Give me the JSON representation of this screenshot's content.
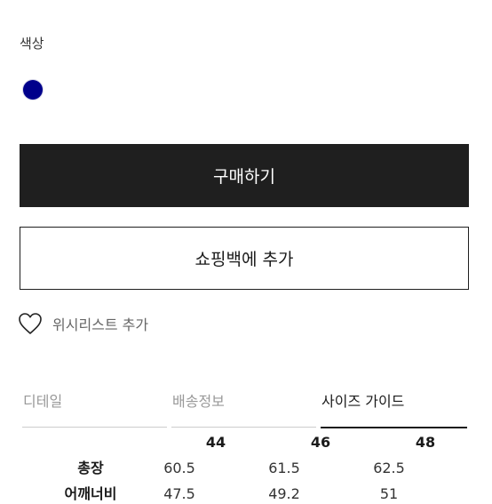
{
  "color_section": {
    "label": "색상",
    "swatch_color": "#00008b"
  },
  "buttons": {
    "buy_label": "구매하기",
    "add_to_bag_label": "쇼핑백에 추가"
  },
  "wishlist": {
    "label": "위시리스트 추가",
    "icon": "heart-outline-icon"
  },
  "tabs": [
    {
      "label": "디테일",
      "active": false
    },
    {
      "label": "배송정보",
      "active": false
    },
    {
      "label": "사이즈 가이드",
      "active": true
    }
  ],
  "size_table": {
    "sizes": [
      "44",
      "46",
      "48"
    ],
    "rows": [
      {
        "label": "총장",
        "values": [
          "60.5",
          "61.5",
          "62.5"
        ]
      },
      {
        "label": "어깨너비",
        "values": [
          "47.5",
          "49.2",
          "51"
        ]
      }
    ]
  }
}
